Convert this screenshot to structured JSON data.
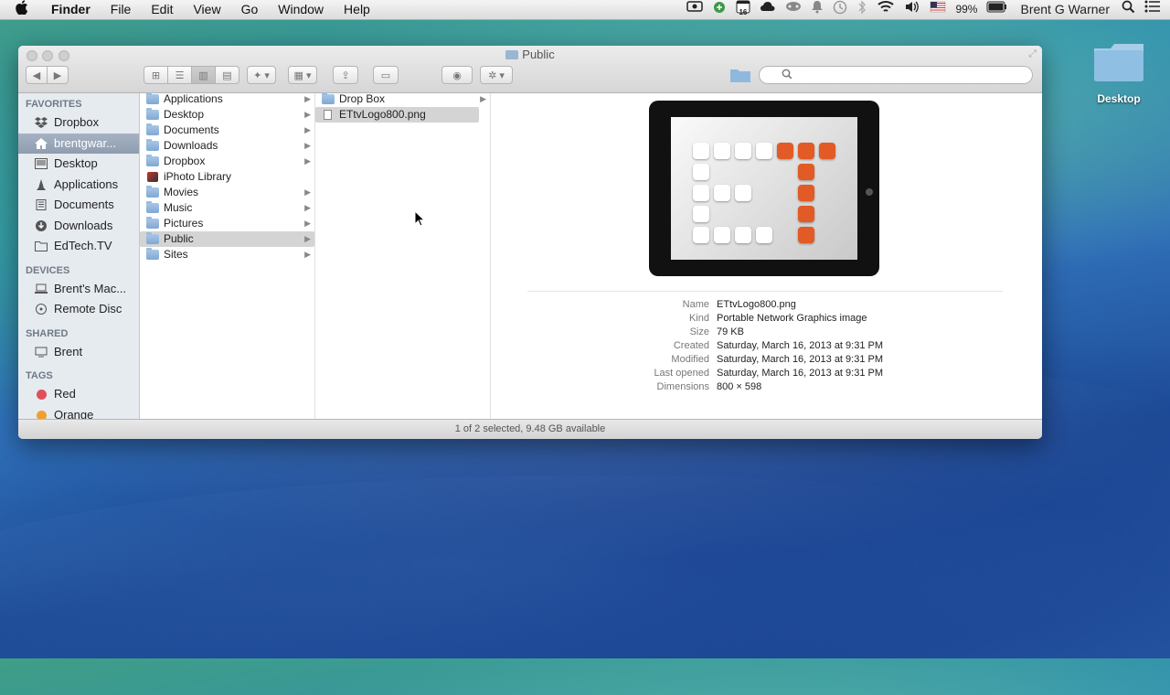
{
  "menubar": {
    "apple_icon": "apple-icon",
    "app_name": "Finder",
    "menus": [
      "File",
      "Edit",
      "View",
      "Go",
      "Window",
      "Help"
    ],
    "battery": "99%",
    "user": "Brent G Warner",
    "calendar_day": "16"
  },
  "window": {
    "title": "Public",
    "search_placeholder": ""
  },
  "sidebar": {
    "favorites_header": "FAVORITES",
    "favorites": [
      "Dropbox",
      "brentgwar...",
      "Desktop",
      "Applications",
      "Documents",
      "Downloads",
      "EdTech.TV"
    ],
    "devices_header": "DEVICES",
    "devices": [
      "Brent's Mac...",
      "Remote Disc"
    ],
    "shared_header": "SHARED",
    "shared": [
      "Brent"
    ],
    "tags_header": "TAGS",
    "tags": [
      "Red",
      "Orange"
    ],
    "tag_colors": [
      "#e0505a",
      "#f0a030"
    ]
  },
  "column1": {
    "items": [
      "Applications",
      "Desktop",
      "Documents",
      "Downloads",
      "Dropbox",
      "iPhoto Library",
      "Movies",
      "Music",
      "Pictures",
      "Public",
      "Sites"
    ]
  },
  "column2": {
    "items": [
      "Drop Box",
      "ETtvLogo800.png"
    ]
  },
  "preview": {
    "labels": [
      "Name",
      "Kind",
      "Size",
      "Created",
      "Modified",
      "Last opened",
      "Dimensions"
    ],
    "values": [
      "ETtvLogo800.png",
      "Portable Network Graphics image",
      "79 KB",
      "Saturday, March 16, 2013 at 9:31 PM",
      "Saturday, March 16, 2013 at 9:31 PM",
      "Saturday, March 16, 2013 at 9:31 PM",
      "800 × 598"
    ]
  },
  "status_bar": "1 of 2 selected, 9.48 GB available",
  "desktop_icon_label": "Desktop",
  "colors": {
    "accent_orange": "#e25a25",
    "selection": "#8e9cb0"
  }
}
